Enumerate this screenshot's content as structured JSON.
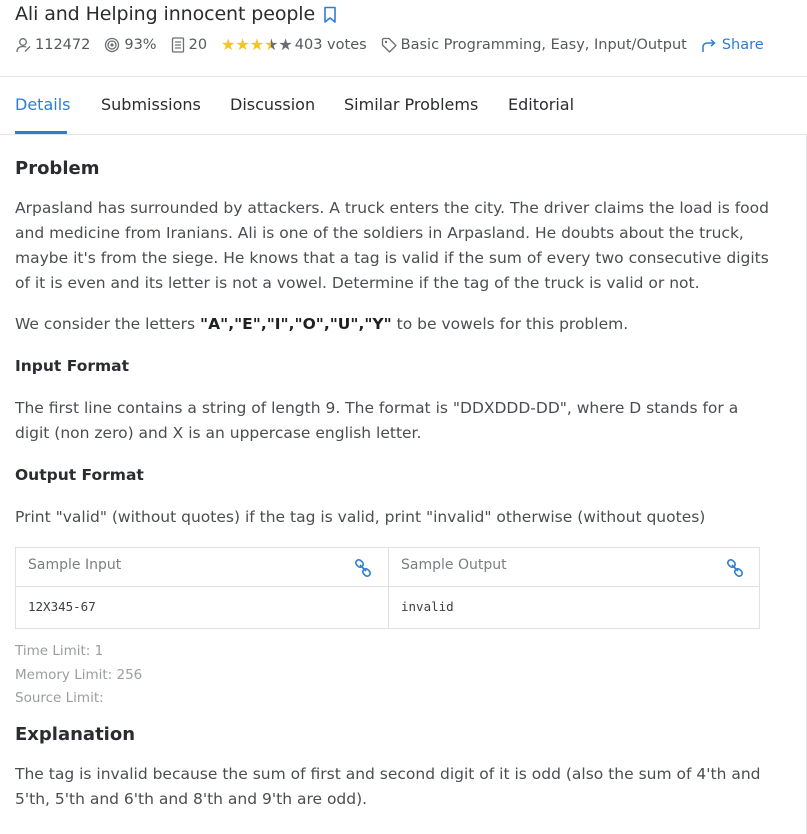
{
  "header": {
    "title": "Ali and Helping innocent people",
    "solved_count": "112472",
    "success_rate": "93%",
    "points": "20",
    "rating": {
      "stars_full": 3,
      "stars_half": 1,
      "stars_total": 5,
      "votes_label": "403 votes"
    },
    "tags": "Basic Programming, Easy, Input/Output",
    "share_label": "Share"
  },
  "tabs": [
    {
      "label": "Details",
      "active": true
    },
    {
      "label": "Submissions",
      "active": false
    },
    {
      "label": "Discussion",
      "active": false
    },
    {
      "label": "Similar Problems",
      "active": false
    },
    {
      "label": "Editorial",
      "active": false
    }
  ],
  "problem": {
    "heading": "Problem",
    "statement": "Arpasland has surrounded by attackers. A truck enters the city. The driver claims the load is food and medicine from Iranians. Ali is one of the soldiers in Arpasland. He doubts about the truck, maybe it's from the siege. He knows that a tag is valid if the sum of every two consecutive digits of it is even and its letter is not a vowel. Determine if the tag of the truck is valid or not.",
    "vowels_prefix": "We consider the letters ",
    "vowels_bold": "\"A\",\"E\",\"I\",\"O\",\"U\",\"Y\"",
    "vowels_suffix": " to be vowels for this problem.",
    "input_heading": "Input Format",
    "input_text": "The first line contains a string of length 9. The format is \"DDXDDD-DD\", where D stands for a digit (non zero) and X is an uppercase english letter.",
    "output_heading": "Output Format",
    "output_text": "Print \"valid\" (without quotes) if the tag is valid, print \"invalid\" otherwise (without quotes)"
  },
  "sample": {
    "input_label": "Sample Input",
    "output_label": "Sample Output",
    "input_value": "12X345-67",
    "output_value": "invalid"
  },
  "limits": {
    "time": "Time Limit: 1",
    "memory": "Memory Limit: 256",
    "source": "Source Limit:"
  },
  "explanation": {
    "heading": "Explanation",
    "text": "The tag is invalid because the sum of first and second digit of it is odd (also the sum of 4'th and 5'th, 5'th and 6'th and 8'th and 9'th are odd)."
  },
  "colors": {
    "accent": "#2d7dd2",
    "star": "#f5c518",
    "star_empty": "#6b6e72"
  }
}
